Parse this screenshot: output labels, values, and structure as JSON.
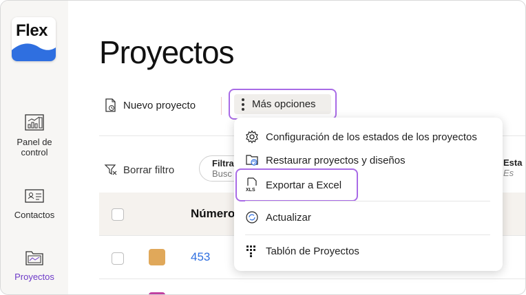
{
  "app": {
    "logo_text": "Flex"
  },
  "sidebar": {
    "items": [
      {
        "label_line1": "Panel de",
        "label_line2": "control",
        "icon": "dashboard-chart-icon"
      },
      {
        "label": "Contactos",
        "icon": "contact-card-icon"
      },
      {
        "label": "Proyectos",
        "icon": "projects-folder-icon",
        "active": true
      }
    ]
  },
  "page": {
    "title": "Proyectos"
  },
  "toolbar": {
    "new_project_label": "Nuevo proyecto",
    "more_options_label": "Más opciones"
  },
  "filters": {
    "clear_label": "Borrar filtro",
    "filter_label": "Filtra",
    "filter_placeholder": "Busc",
    "state_label": "Esta",
    "state_value": "Es"
  },
  "table": {
    "number_header": "Número",
    "rows": [
      {
        "number": "453",
        "color": "#e0a85a"
      }
    ],
    "partial_row_color": "#c040a0"
  },
  "menu": {
    "items": [
      {
        "label": "Configuración de los estados de los proyectos",
        "icon": "gear-icon"
      },
      {
        "label": "Restaurar proyectos y diseños",
        "icon": "restore-folder-icon"
      },
      {
        "label": "Exportar a Excel",
        "icon": "xls-file-icon"
      },
      {
        "label": "Actualizar",
        "icon": "refresh-icon"
      },
      {
        "label": "Tablón de Proyectos",
        "icon": "board-grid-icon"
      }
    ]
  },
  "colors": {
    "accent": "#6d3ac8",
    "highlight_border": "#a86ae6",
    "link": "#2f6fe0",
    "logo_wave": "#2f6fe0"
  }
}
